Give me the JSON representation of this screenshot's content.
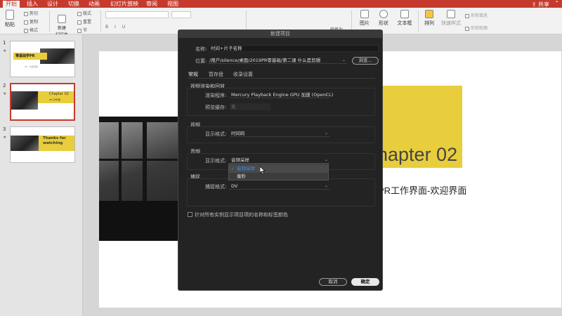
{
  "menu_tabs": [
    "开始",
    "插入",
    "设计",
    "切换",
    "动画",
    "幻灯片放映",
    "审阅",
    "视图"
  ],
  "share_label": "共享",
  "ribbon": {
    "paste": "粘贴",
    "cut": "剪切",
    "copy": "复制",
    "format": "格式",
    "new_slide": "新建\n幻灯片",
    "layout": "版式",
    "reset": "重置",
    "section": "节",
    "convert": "转换为",
    "picture": "图片",
    "shape": "形状",
    "textbox": "文本框",
    "arrange": "排列",
    "quick_styles": "快速样式",
    "shape_fill": "形状填充",
    "shape_outline": "形状轮廓"
  },
  "slides": [
    {
      "num": "1",
      "title": "零基础学PR",
      "subtitle": "PR · 基础课程"
    },
    {
      "num": "2",
      "title": "Chapter 02",
      "subtitle": "PR工作界面"
    },
    {
      "num": "3",
      "title": "Thanks for\nwatching"
    }
  ],
  "main_slide": {
    "chapter": "hapter  02",
    "subtitle": "PR工作界面-欢迎界面"
  },
  "dialog": {
    "title": "新建项目",
    "name_label": "名称:",
    "name_value": "时间+片子名称",
    "location_label": "位置:",
    "location_value": "/用户/silence/桌面/2019PR零基础/第二课  什么是剪辑",
    "browse": "浏览...",
    "tabs": [
      "常规",
      "暂存盘",
      "收录设置"
    ],
    "render_section": "视频渲染和回放",
    "renderer_label": "渲染程序:",
    "renderer_value": "Mercury Playback Engine GPU 加速 (OpenCL)",
    "preview_cache_label": "预览缓存:",
    "preview_cache_value": "无",
    "video_section": "视频",
    "video_format_label": "显示格式:",
    "video_format_value": "时间码",
    "audio_section": "音频",
    "audio_format_label": "显示格式:",
    "audio_format_value": "音频采样",
    "capture_section": "捕捉",
    "capture_format_label": "捕捉格式:",
    "capture_format_value": "DV",
    "checkbox_label": "针对所有实例显示项目项的名称和标签颜色",
    "cancel": "取消",
    "ok": "确定",
    "audio_options": [
      "音频采样",
      "毫秒"
    ],
    "audio_selected": "音频采样"
  },
  "colors": {
    "accent_red": "#c53a2c",
    "slide_yellow": "#e8cd3c",
    "dialog_bg": "#232323",
    "menu_highlight": "#3a8ee8"
  }
}
